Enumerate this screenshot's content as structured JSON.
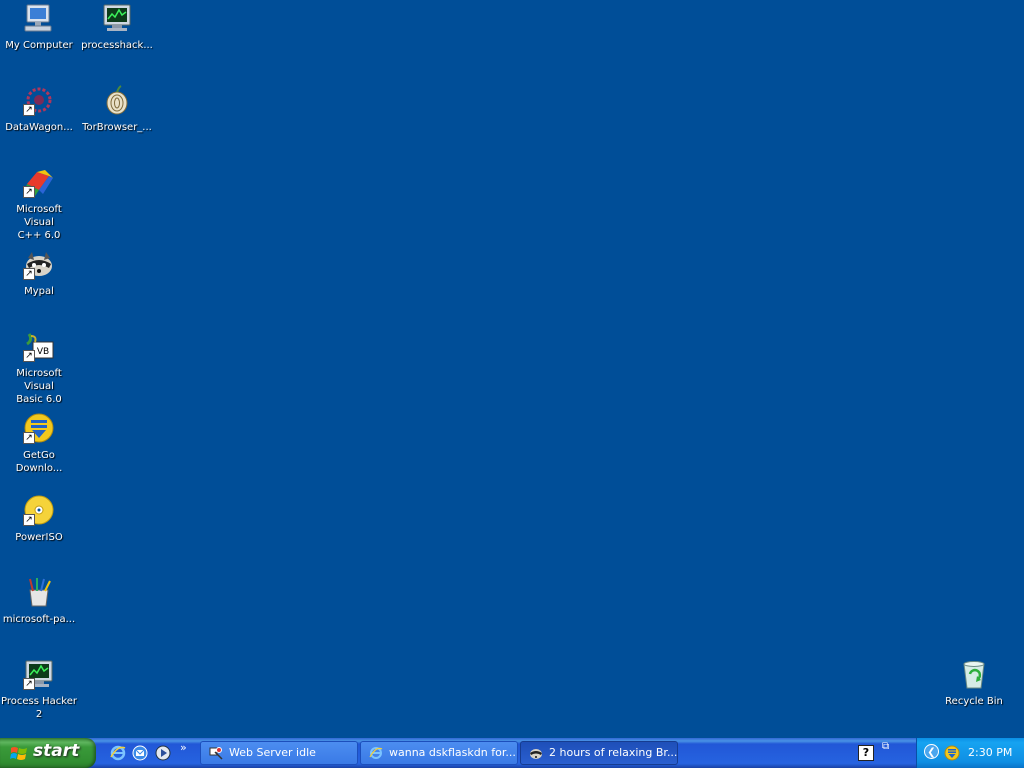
{
  "desktop": {
    "background_color": "#004e98",
    "icons": [
      {
        "name": "My Computer",
        "icon": "my-computer-icon",
        "shortcut": false
      },
      {
        "name": "processhack...",
        "icon": "process-hacker-icon",
        "shortcut": false
      },
      {
        "name": "DataWagon...",
        "icon": "datawagon-icon",
        "shortcut": true
      },
      {
        "name": "TorBrowser_...",
        "icon": "tor-onion-icon",
        "shortcut": false
      },
      {
        "name": "Microsoft Visual\nC++ 6.0",
        "icon": "visual-cpp-icon",
        "shortcut": true
      },
      {
        "name": "Mypal",
        "icon": "mypal-raccoon-icon",
        "shortcut": true
      },
      {
        "name": "Microsoft Visual\nBasic 6.0",
        "icon": "visual-basic-icon",
        "shortcut": true
      },
      {
        "name": "GetGo\nDownlo...",
        "icon": "getgo-download-icon",
        "shortcut": true
      },
      {
        "name": "PowerISO",
        "icon": "poweriso-disc-icon",
        "shortcut": true
      },
      {
        "name": "microsoft-pa...",
        "icon": "paint-brushes-icon",
        "shortcut": false
      },
      {
        "name": "Process Hacker\n2",
        "icon": "process-hacker-icon",
        "shortcut": true
      },
      {
        "name": "Recycle Bin",
        "icon": "recycle-bin-icon",
        "shortcut": false
      }
    ]
  },
  "taskbar": {
    "start_label": "start",
    "quick_launch": [
      {
        "icon": "internet-explorer-icon"
      },
      {
        "icon": "outlook-express-icon"
      },
      {
        "icon": "media-player-icon"
      }
    ],
    "more_label": "»",
    "tasks": [
      {
        "label": "Web Server idle",
        "icon": "web-server-icon",
        "active": false
      },
      {
        "label": "wanna dskflaskdn for...",
        "icon": "internet-explorer-icon",
        "active": false
      },
      {
        "label": "2 hours of relaxing Br...",
        "icon": "mypal-raccoon-icon",
        "active": true
      }
    ],
    "help_label": "?",
    "restore_label": "⧉",
    "tray": {
      "chevron": "❮",
      "clock": "2:30 PM"
    }
  }
}
